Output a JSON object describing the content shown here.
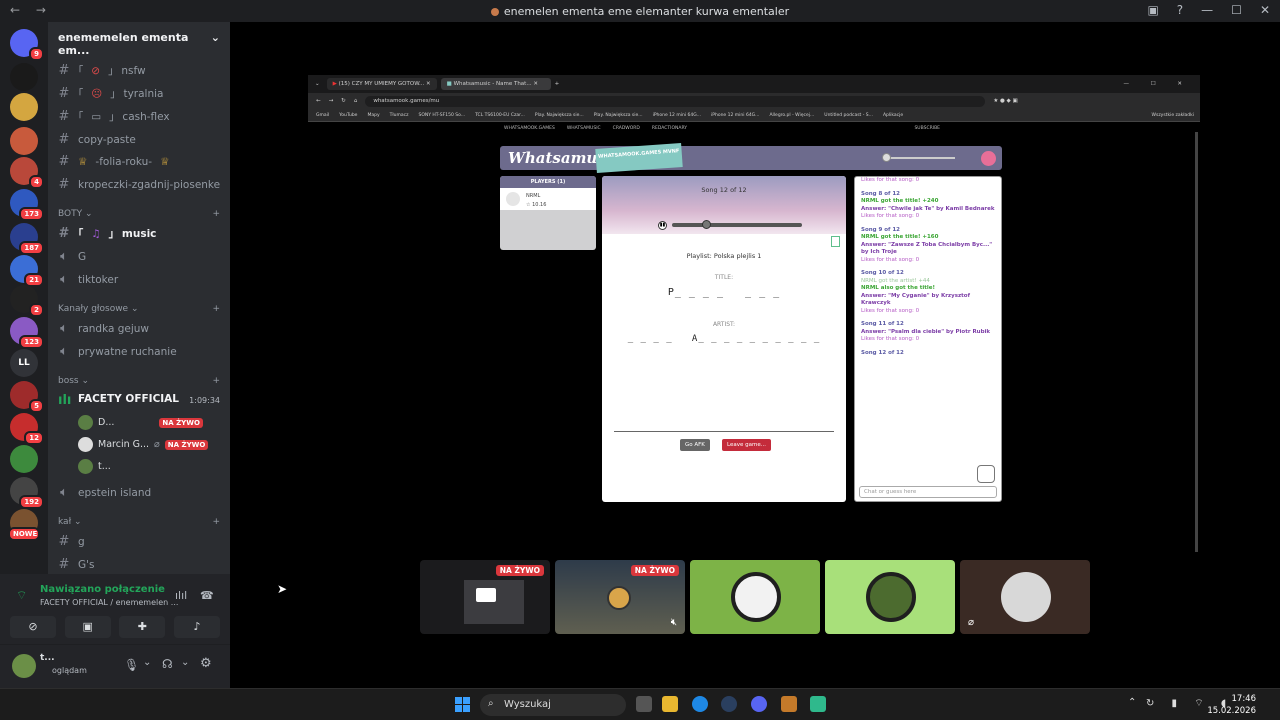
{
  "window": {
    "title": "enemelen ementa eme elemanter kurwa ementaler"
  },
  "servers": [
    {
      "name": "discord",
      "badge": "9",
      "color": "#5865f2"
    },
    {
      "name": "nlb",
      "badge": "",
      "color": "#1a1a1a"
    },
    {
      "name": "s3",
      "badge": "",
      "color": "#d4a640"
    },
    {
      "name": "s4",
      "badge": "",
      "color": "#c85a3c"
    },
    {
      "name": "s5",
      "badge": "4",
      "color": "#b9483a"
    },
    {
      "name": "s6",
      "badge": "173",
      "color": "#2f59c0"
    },
    {
      "name": "haze",
      "badge": "187",
      "color": "#2a3f8f"
    },
    {
      "name": "s8",
      "badge": "21",
      "color": "#3b6ed6"
    },
    {
      "name": "s9",
      "badge": "2",
      "color": "#222"
    },
    {
      "name": "s10",
      "badge": "123",
      "color": "#8a5ac4"
    },
    {
      "name": "LL",
      "badge": "",
      "color": "#313338"
    },
    {
      "name": "s12",
      "badge": "5",
      "color": "#9e2b2b"
    },
    {
      "name": "s13",
      "badge": "12",
      "color": "#c62d2d"
    },
    {
      "name": "s14",
      "badge": "",
      "color": "#3d8a3d"
    },
    {
      "name": "s15",
      "badge": "192",
      "color": "#444"
    },
    {
      "name": "s16",
      "badge": "NOWE",
      "color": "#7a5230"
    }
  ],
  "guild": {
    "name": "enememelen ementa em..."
  },
  "channels": {
    "nsfw": "nsfw",
    "tyralnia": "tyralnia",
    "cashflex": "cash-flex",
    "copypaste": "copy-paste",
    "folia": "-folia-roku-",
    "kropeczki": "kropeczki-zgadnij-piosenke",
    "cat_boty": "BOTY",
    "music": "music",
    "g": "G",
    "tiktoker": "tiktoker",
    "cat_glosowe": "Kanały głosowe",
    "randka": "randka gejuw",
    "prywatne": "prywatne ruchanie",
    "cat_boss": "boss",
    "facety": "FACETY OFFICIAL",
    "facety_time": "1:09:34",
    "user1": "D...",
    "user2": "Marcin G...",
    "user3": "t...",
    "live": "NA ŻYWO",
    "epstein": "epstein island",
    "cat_kal": "kał",
    "g2": "g",
    "gs": "G's"
  },
  "voice": {
    "status": "Nawiązano połączenie",
    "channel": "FACETY OFFICIAL / enememelen ..."
  },
  "me": {
    "name": "t...",
    "status": "oglądam"
  },
  "browser": {
    "tab1": "(15) CZY MY UMIEMY GOTOW...",
    "tab2": "Whatsamusic - Name That...",
    "url": "whatsamook.games/mu",
    "bookmarks": [
      "Gmail",
      "YouTube",
      "Mapy",
      "Tłumacz",
      "SONY HT-SF150 So...",
      "TCL TS6100-EU Czar...",
      "Play. Największa sie...",
      "Play. Największa sie...",
      "iPhone 12 mini 64G...",
      "iPhone 12 mini 64G...",
      "Allegro.pl - Więcej...",
      "Untitled podcast - S...",
      "Aplikacje",
      "Wszystkie zakładki"
    ]
  },
  "site": {
    "nav": [
      "WHATSAMOOK.GAMES",
      "WHATSAMUSIC",
      "CRADWORD",
      "REDACTIONARY",
      "SUBSCRIBE"
    ],
    "logo": "Whatsamusic",
    "mvnf": "WHATSAMOOK.GAMES MVNF",
    "players_header": "PLAYERS (1)",
    "player_name": "NRML",
    "player_score": "10.16",
    "song": "Song 12 of 12",
    "playlist": "Playlist: Polska plejlis 1",
    "title_label": "TITLE:",
    "title_blanks": "P_ _ _ _   _ _ _",
    "artist_label": "ARTIST:",
    "artist_blanks": "_ _ _ _   A_ _ _ _ _ _ _ _ _ _",
    "go_afk": "Go AFK",
    "leave": "Leave game...",
    "chat_placeholder": "Chat or guess here"
  },
  "chat": [
    {
      "t": "lk",
      "text": "Likes for that song: 0"
    },
    {
      "t": "sh",
      "text": "Song 8 of 12"
    },
    {
      "t": "g",
      "text": "NRML got the title! +240"
    },
    {
      "t": "pu",
      "text": "Answer: \"Chwile jak Te\" by Kamil Bednarek"
    },
    {
      "t": "lk",
      "text": "Likes for that song: 0"
    },
    {
      "t": "sh",
      "text": "Song 9 of 12"
    },
    {
      "t": "g",
      "text": "NRML got the title! +160"
    },
    {
      "t": "pu",
      "text": "Answer: \"Zawsze Z Toba Chcialbym Byc...\" by Ich Troje"
    },
    {
      "t": "lk",
      "text": "Likes for that song: 0"
    },
    {
      "t": "sh",
      "text": "Song 10 of 12"
    },
    {
      "t": "gr",
      "text": "NRML got the artist! +44"
    },
    {
      "t": "g",
      "text": "NRML also got the title!"
    },
    {
      "t": "pu",
      "text": "Answer: \"My Cyganie\" by Krzysztof Krawczyk"
    },
    {
      "t": "lk",
      "text": "Likes for that song: 0"
    },
    {
      "t": "sh",
      "text": "Song 11 of 12"
    },
    {
      "t": "pu",
      "text": "Answer: \"Psalm dla ciebie\" by Piotr Rubik"
    },
    {
      "t": "lk",
      "text": "Likes for that song: 0"
    },
    {
      "t": "sh",
      "text": "Song 12 of 12"
    }
  ],
  "streams": {
    "live": "NA ŻYWO"
  },
  "taskbar": {
    "search": "Wyszukaj",
    "time": "17:46",
    "date": "15.02.2026"
  }
}
